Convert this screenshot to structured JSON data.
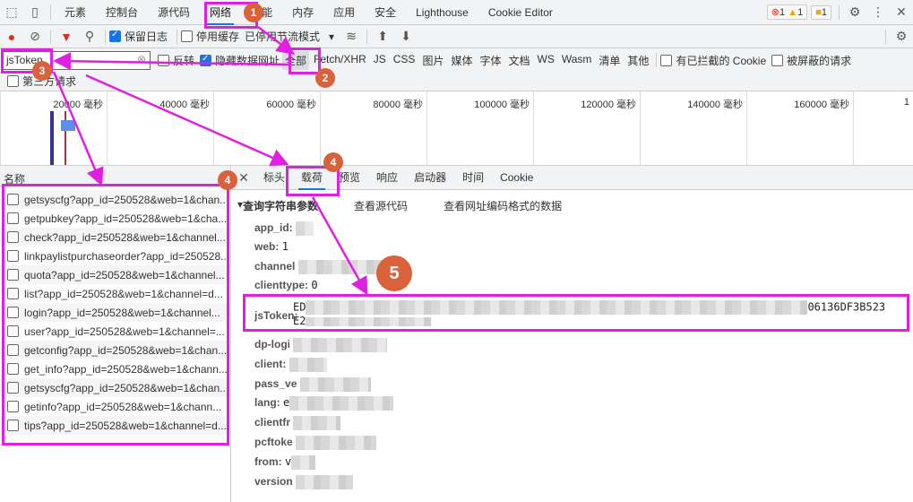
{
  "main_tabs": [
    "元素",
    "控制台",
    "源代码",
    "网络",
    "性能",
    "内存",
    "应用",
    "安全",
    "Lighthouse",
    "Cookie Editor"
  ],
  "active_tab": "网络",
  "status": {
    "errors": "1",
    "warnings": "1",
    "issues": "1"
  },
  "toolbar": {
    "preserve_log": "保留日志",
    "disable_cache": "停用缓存",
    "throttle": "已停用节流模式"
  },
  "filter": {
    "value": "jsToken",
    "invert": "反转",
    "hide_data_urls": "隐藏数据网址",
    "types": [
      "全部",
      "Fetch/XHR",
      "JS",
      "CSS",
      "图片",
      "媒体",
      "字体",
      "文档",
      "WS",
      "Wasm",
      "清单",
      "其他"
    ],
    "blocked_cookies": "有已拦截的 Cookie",
    "blocked_requests": "被屏蔽的请求",
    "third_party": "第三方请求"
  },
  "timeline_ticks": [
    "20000 毫秒",
    "40000 毫秒",
    "60000 毫秒",
    "80000 毫秒",
    "100000 毫秒",
    "120000 毫秒",
    "140000 毫秒",
    "160000 毫秒",
    "1"
  ],
  "list": {
    "header": "名称",
    "items": [
      "getsyscfg?app_id=250528&web=1&chan...",
      "getpubkey?app_id=250528&web=1&cha...",
      "check?app_id=250528&web=1&channel...",
      "linkpaylistpurchaseorder?app_id=250528...",
      "quota?app_id=250528&web=1&channel...",
      "list?app_id=250528&web=1&channel=d...",
      "login?app_id=250528&web=1&channel...",
      "user?app_id=250528&web=1&channel=...",
      "getconfig?app_id=250528&web=1&chan...",
      "get_info?app_id=250528&web=1&chann...",
      "getsyscfg?app_id=250528&web=1&chan...",
      "getinfo?app_id=250528&web=1&chann...",
      "tips?app_id=250528&web=1&channel=d..."
    ]
  },
  "detail": {
    "tabs": [
      "标头",
      "载荷",
      "预览",
      "响应",
      "启动器",
      "时间",
      "Cookie"
    ],
    "active": "载荷",
    "section": "查询字符串参数",
    "view_source": "查看源代码",
    "view_url_encoded": "查看网址编码格式的数据",
    "params": [
      {
        "k": "app_id:",
        "v": ""
      },
      {
        "k": "web:",
        "v": "1"
      },
      {
        "k": "channel",
        "v": ""
      },
      {
        "k": "clienttype:",
        "v": "0"
      },
      {
        "k": "jsToken:",
        "v": "ED",
        "v_end": "06136DF3B523",
        "v2": "E2"
      },
      {
        "k": "dp-logi",
        "v": ""
      },
      {
        "k": "client:",
        "v": ""
      },
      {
        "k": "pass_ve",
        "v": ""
      },
      {
        "k": "lang:",
        "v": "e"
      },
      {
        "k": "clientfr",
        "v": ""
      },
      {
        "k": "pcftoke",
        "v": ""
      },
      {
        "k": "from:",
        "v": "v"
      },
      {
        "k": "version",
        "v": ""
      }
    ]
  },
  "annotations": [
    "1",
    "2",
    "3",
    "4",
    "4",
    "5"
  ],
  "colors": {
    "annotation_box": "#e020e0",
    "annotation_badge": "#d9623b",
    "accent": "#1a73e8"
  }
}
